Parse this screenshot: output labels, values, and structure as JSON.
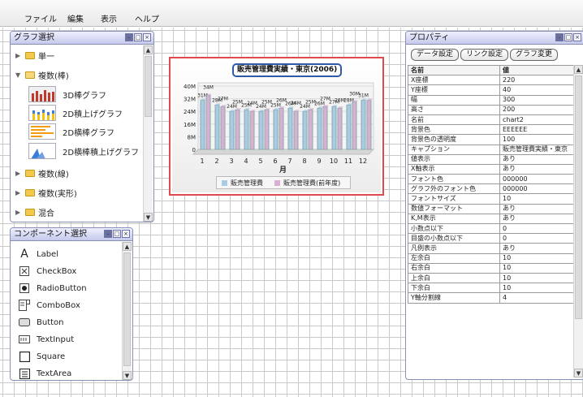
{
  "menu": {
    "items": [
      "ファイル",
      "編集",
      "表示",
      "ヘルプ"
    ]
  },
  "graph_panel": {
    "title": "グラフ選択",
    "groups": [
      {
        "label": "単一",
        "expanded": false
      },
      {
        "label": "複数(棒)",
        "expanded": true
      },
      {
        "label": "複数(線)",
        "expanded": false
      },
      {
        "label": "複数(実形)",
        "expanded": false
      },
      {
        "label": "混合",
        "expanded": false
      }
    ],
    "sub_items": [
      "3D棒グラフ",
      "2D積上げグラフ",
      "2D横棒グラフ",
      "2D横棒積上げグラフ"
    ]
  },
  "component_panel": {
    "title": "コンポーネント選択",
    "items": [
      {
        "label": "Label",
        "icon": "label-icon"
      },
      {
        "label": "CheckBox",
        "icon": "checkbox-icon"
      },
      {
        "label": "RadioButton",
        "icon": "radio-icon"
      },
      {
        "label": "ComboBox",
        "icon": "combobox-icon"
      },
      {
        "label": "Button",
        "icon": "button-icon"
      },
      {
        "label": "TextInput",
        "icon": "textinput-icon"
      },
      {
        "label": "Square",
        "icon": "square-icon"
      },
      {
        "label": "TextArea",
        "icon": "textarea-icon"
      }
    ]
  },
  "chart_widget": {
    "title": "販売管理費実績・東京(2006)",
    "xlabel": "月",
    "legend": [
      "販売管理費",
      "販売管理費(前年度)"
    ]
  },
  "chart_data": {
    "type": "bar",
    "title": "販売管理費実績・東京(2006)",
    "xlabel": "月",
    "ylabel": "",
    "categories": [
      "1",
      "2",
      "3",
      "4",
      "5",
      "6",
      "7",
      "8",
      "9",
      "10",
      "11",
      "12"
    ],
    "yticks": [
      "40M",
      "32M",
      "24M",
      "16M",
      "8M",
      "0"
    ],
    "ylim": [
      0,
      40
    ],
    "series": [
      {
        "name": "販売管理費",
        "values": [
          31,
          28,
          24,
          25,
          24,
          25,
          26,
          24,
          26,
          27,
          28,
          31
        ],
        "labels": [
          "31M",
          "28M",
          "24M",
          "25M",
          "24M",
          "25M",
          "26M",
          "24M",
          "26M",
          "27M",
          "28M",
          "31M"
        ],
        "color": "#a9cbe6"
      },
      {
        "name": "販売管理費(前年度)",
        "values": [
          34,
          27,
          25,
          24,
          25,
          26,
          24,
          25,
          27,
          26,
          30,
          31
        ],
        "labels": [
          "34M",
          "27M",
          "25M",
          "24M",
          "25M",
          "26M",
          "24M",
          "25M",
          "27M",
          "26M",
          "30M",
          ""
        ],
        "color": "#d9b0d4"
      }
    ]
  },
  "property_panel": {
    "title": "プロパティ",
    "buttons": [
      "データ設定",
      "リンク設定",
      "グラフ変更"
    ],
    "header": {
      "name": "名前",
      "value": "値"
    },
    "rows": [
      {
        "name": "X座標",
        "value": "220"
      },
      {
        "name": "Y座標",
        "value": "40"
      },
      {
        "name": "幅",
        "value": "300"
      },
      {
        "name": "高さ",
        "value": "200"
      },
      {
        "name": "名前",
        "value": "chart2"
      },
      {
        "name": "背景色",
        "value": "EEEEEE"
      },
      {
        "name": "背景色の透明度",
        "value": "100"
      },
      {
        "name": "キャプション",
        "value": "販売管理費実績・東京"
      },
      {
        "name": "値表示",
        "value": "あり"
      },
      {
        "name": "X軸表示",
        "value": "あり"
      },
      {
        "name": "フォント色",
        "value": "000000"
      },
      {
        "name": "グラフ外のフォント色",
        "value": "000000"
      },
      {
        "name": "フォントサイズ",
        "value": "10"
      },
      {
        "name": "数値フォーマット",
        "value": "あり"
      },
      {
        "name": "K,M表示",
        "value": "あり"
      },
      {
        "name": "小数点以下",
        "value": "0"
      },
      {
        "name": "目盛の小数点以下",
        "value": "0"
      },
      {
        "name": "凡例表示",
        "value": "あり"
      },
      {
        "name": "左余白",
        "value": "10"
      },
      {
        "name": "右余白",
        "value": "10"
      },
      {
        "name": "上余白",
        "value": "10"
      },
      {
        "name": "下余白",
        "value": "10"
      },
      {
        "name": "Y軸分割線",
        "value": "4"
      }
    ]
  },
  "colors": {
    "panel_border": "#8a8fb8",
    "selection_border": "#e24b4b",
    "title_border": "#2e5aa8"
  }
}
